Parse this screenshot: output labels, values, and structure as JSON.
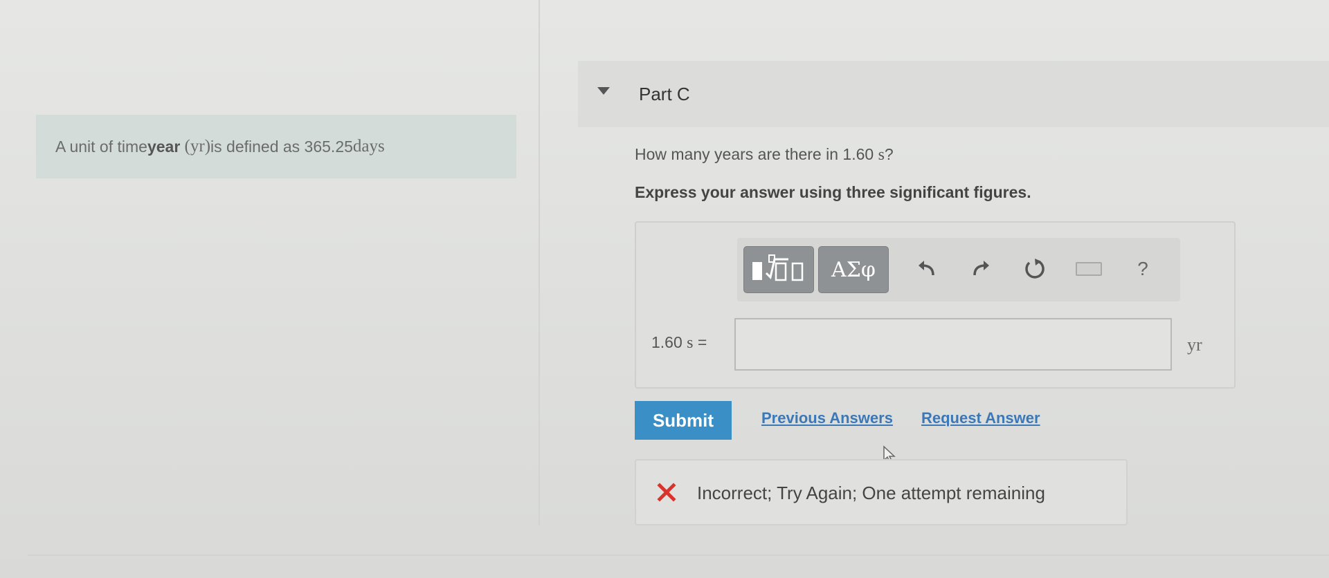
{
  "problem": {
    "statement_prefix": "A unit of time ",
    "statement_term": "year",
    "statement_symbol": "(yr)",
    "statement_mid": " is defined as 365.25 ",
    "statement_unit": "days"
  },
  "part": {
    "title": "Part C"
  },
  "question": {
    "prefix": "How many years are there in 1.60 ",
    "unit": "s",
    "suffix": "?"
  },
  "instruction": "Express your answer using three significant figures.",
  "toolbar": {
    "greek_label": "ΑΣφ",
    "help_label": "?"
  },
  "equation": {
    "lhs_value": "1.60 ",
    "lhs_unit": "s",
    "equals": " =",
    "answer_value": "",
    "unit": "yr"
  },
  "actions": {
    "submit_label": "Submit",
    "previous_answers_label": "Previous Answers",
    "request_answer_label": "Request Answer"
  },
  "feedback": {
    "message": "Incorrect; Try Again; One attempt remaining",
    "status_color": "#d9342b"
  },
  "colors": {
    "accent": "#3b8fc7",
    "link": "#3b78b8",
    "error": "#d9342b"
  }
}
